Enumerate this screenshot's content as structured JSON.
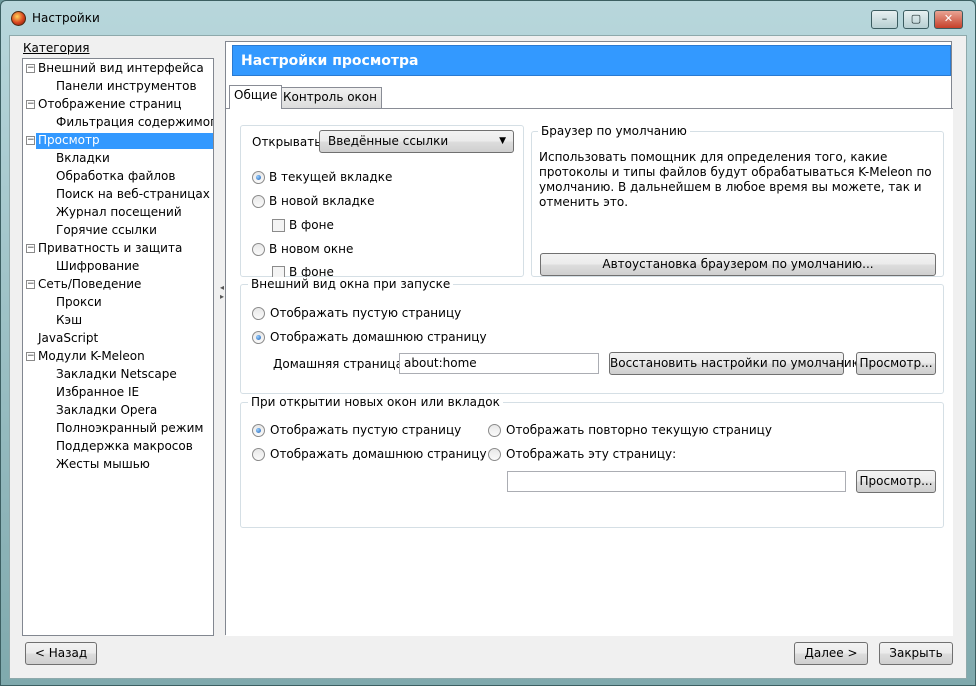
{
  "window": {
    "title": "Настройки",
    "caption_buttons": {
      "minimize": "–",
      "maximize": "▢",
      "close": "✕"
    }
  },
  "category": {
    "label": "Категория",
    "items": [
      {
        "label": "Внешний вид интерфейса",
        "level": 0,
        "expander": "⊟"
      },
      {
        "label": "Панели инструментов",
        "level": 1
      },
      {
        "label": "Отображение страниц",
        "level": 0,
        "expander": "⊟"
      },
      {
        "label": "Фильтрация содержимого",
        "level": 1
      },
      {
        "label": "Просмотр",
        "level": 0,
        "expander": "⊟",
        "selected": true
      },
      {
        "label": "Вкладки",
        "level": 1
      },
      {
        "label": "Обработка файлов",
        "level": 1
      },
      {
        "label": "Поиск на веб-страницах",
        "level": 1
      },
      {
        "label": "Журнал посещений",
        "level": 1
      },
      {
        "label": "Горячие ссылки",
        "level": 1
      },
      {
        "label": "Приватность и защита",
        "level": 0,
        "expander": "⊟"
      },
      {
        "label": "Шифрование",
        "level": 1
      },
      {
        "label": "Сеть/Поведение",
        "level": 0,
        "expander": "⊟"
      },
      {
        "label": "Прокси",
        "level": 1
      },
      {
        "label": "Кэш",
        "level": 1
      },
      {
        "label": "JavaScript",
        "level": 0
      },
      {
        "label": "Модули K-Meleon",
        "level": 0,
        "expander": "⊟"
      },
      {
        "label": "Закладки Netscape",
        "level": 1
      },
      {
        "label": "Избранное IE",
        "level": 1
      },
      {
        "label": "Закладки Opera",
        "level": 1
      },
      {
        "label": "Полноэкранный режим",
        "level": 1
      },
      {
        "label": "Поддержка макросов",
        "level": 1
      },
      {
        "label": "Жесты мышью",
        "level": 1
      }
    ]
  },
  "main": {
    "header": "Настройки просмотра",
    "tabs": [
      {
        "label": "Общие",
        "active": true
      },
      {
        "label": "Контроль окон",
        "active": false
      }
    ],
    "open_group": {
      "open_label": "Открывать",
      "open_select_value": "Введённые ссылки",
      "radio_current_tab": "В текущей вкладке",
      "radio_new_tab": "В новой вкладке",
      "check_bg_tab": "В фоне",
      "radio_new_window": "В новом окне",
      "check_bg_window": "В фоне"
    },
    "default_browser": {
      "title": "Браузер по умолчанию",
      "description": "Использовать помощник для определения того, какие протоколы и типы файлов будут обрабатываться K-Meleon по умолчанию. В дальнейшем в любое время вы можете, так и отменить это.",
      "button": "Автоустановка браузером по умолчанию..."
    },
    "startup": {
      "title": "Внешний вид окна при запуске",
      "radio_blank": "Отображать пустую страницу",
      "radio_home": "Отображать домашнюю страницу",
      "home_label": "Домашняя страница:",
      "home_value": "about:home",
      "restore_button": "Восстановить настройки по умолчанию",
      "browse_button": "Просмотр..."
    },
    "new_windows": {
      "title": "При открытии новых окон или вкладок",
      "radio_blank": "Отображать пустую страницу",
      "radio_home": "Отображать домашнюю страницу",
      "radio_repeat": "Отображать повторно текущую страницу",
      "radio_this": "Отображать эту страницу:",
      "page_value": "",
      "browse_button": "Просмотр..."
    }
  },
  "footer": {
    "back_button": "< Назад",
    "next_button": "Далее >",
    "close_button": "Закрыть"
  },
  "colors": {
    "accent": "#3399ff",
    "selection": "#3399ff"
  }
}
